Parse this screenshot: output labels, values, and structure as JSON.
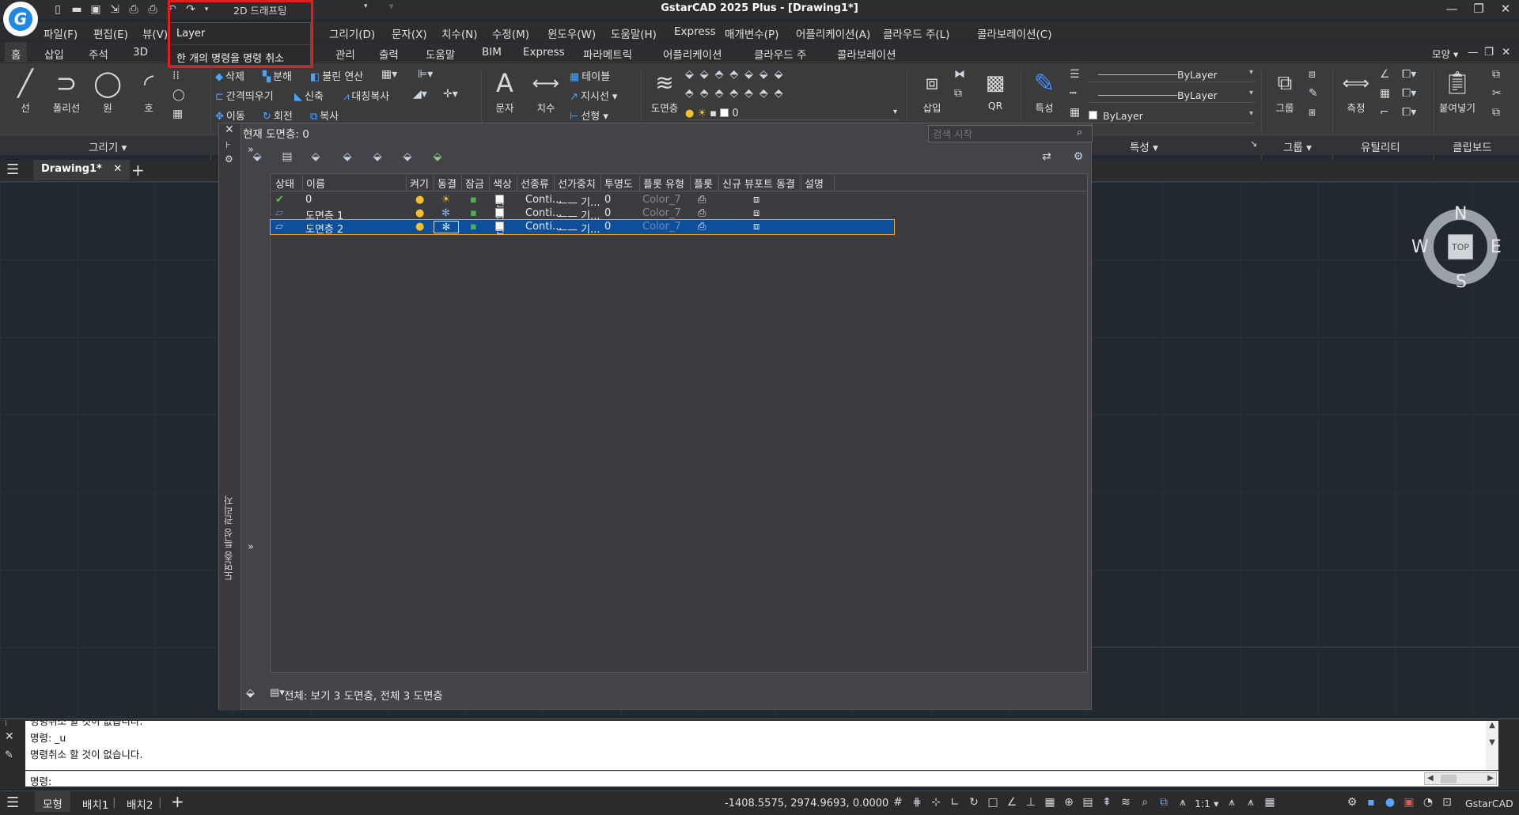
{
  "app": {
    "title": "GstarCAD 2025 Plus - [Drawing1*]",
    "workspace": "2D 드래프팅",
    "logo_letter": "G"
  },
  "undo_dropdown": {
    "items": [
      "Layer",
      "한 개의 명령을 명령 취소"
    ]
  },
  "menu": {
    "items": [
      "파일(F)",
      "편집(E)",
      "뷰(V)",
      "그리기(D)",
      "문자(X)",
      "치수(N)",
      "수정(M)",
      "윈도우(W)",
      "도움말(H)",
      "Express",
      "매개변수(P)",
      "어플리케이션(A)",
      "클라우드 주(L)",
      "콜라보레이션(C)"
    ]
  },
  "ribbon_tabs": {
    "items": [
      "홈",
      "삽입",
      "주석",
      "3D",
      "관리",
      "출력",
      "도움말",
      "BIM",
      "Express",
      "파라메트릭",
      "어플리케이션",
      "클라우드 주",
      "콜라보레이션"
    ],
    "right_label": "모양"
  },
  "ribbon": {
    "draw": [
      "선",
      "폴리선",
      "원",
      "호"
    ],
    "modify": [
      "삭제",
      "분해",
      "불린 연산",
      "간격띄우기",
      "신축",
      "대칭복사",
      "이동",
      "회전",
      "복사"
    ],
    "annotation": [
      "문자",
      "치수",
      "테이블",
      "지시선",
      "선형"
    ],
    "layer_button": "도면층",
    "layer_value": "0",
    "block": [
      "삽입",
      "QR"
    ],
    "properties_button": "특성",
    "property_values": [
      "ByLayer",
      "ByLayer",
      "ByLayer"
    ],
    "group_button": "그룹",
    "measure_button": "측정",
    "paste_button": "붙여넣기",
    "panel_titles": [
      "그리기",
      "특성",
      "그룹",
      "유틸리티",
      "클립보드"
    ]
  },
  "document": {
    "tab": "Drawing1*"
  },
  "layer_manager": {
    "vertical_title": "도면층 특성 관리자",
    "current_layer": "현재 도면층: 0",
    "search_placeholder": "검색 시작",
    "columns": [
      "상태",
      "이름",
      "켜기",
      "동결",
      "잠금",
      "색상",
      "선종류",
      "선가중치",
      "투명도",
      "플롯 유형",
      "플롯",
      "신규 뷰포트 동결",
      "설명"
    ],
    "layers": [
      {
        "status": "✔",
        "name": "0",
        "color": "흰",
        "linetype": "Conti...",
        "lineweight": "—— 기...",
        "transparency": "0",
        "plot_style": "Color_7",
        "selected": false
      },
      {
        "status": "▱",
        "name": "도면층 1",
        "color": "흰",
        "linetype": "Conti...",
        "lineweight": "—— 기...",
        "transparency": "0",
        "plot_style": "Color_7",
        "selected": false
      },
      {
        "status": "▱",
        "name": "도면층 2",
        "color": "흰",
        "linetype": "Conti...",
        "lineweight": "—— 기...",
        "transparency": "0",
        "plot_style": "Color_7",
        "selected": true
      }
    ],
    "footer": "전체: 보기 3 도면층, 전체 3 도면층"
  },
  "viewcube": {
    "north": "N",
    "south": "S",
    "east": "E",
    "west": "W",
    "top": "TOP"
  },
  "command_line": {
    "history": [
      "명령취소 할 것이 없습니다.",
      "명령: _u",
      "명령취소 할 것이 없습니다."
    ],
    "prompt": "명령:"
  },
  "status": {
    "tabs": [
      "모형",
      "배치1",
      "배치2"
    ],
    "coords": "-1408.5575, 2974.9693, 0.0000",
    "scale": "1:1",
    "brand": "GstarCAD"
  },
  "colors": {
    "accent": "#1e88e5",
    "selection": "#0e4f9c",
    "highlight_box": "#e01e1e"
  }
}
